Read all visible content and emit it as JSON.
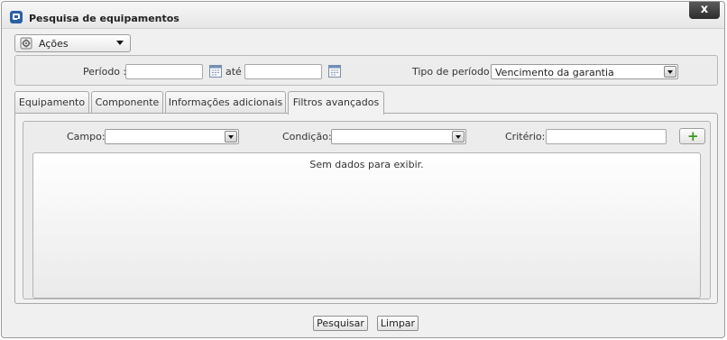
{
  "window": {
    "title": "Pesquisa de equipamentos",
    "close_label": "x"
  },
  "actions": {
    "label": "Ações"
  },
  "period": {
    "label": "Período :",
    "start_value": "",
    "until_label": "até",
    "end_value": "",
    "type_label": "Tipo de período :",
    "type_value": "Vencimento da garantia"
  },
  "tabs": [
    {
      "label": "Equipamento"
    },
    {
      "label": "Componente"
    },
    {
      "label": "Informações adicionais"
    },
    {
      "label": "Filtros avançados",
      "active": true
    }
  ],
  "filters": {
    "field_label": "Campo:",
    "field_value": "",
    "condition_label": "Condição:",
    "condition_value": "",
    "criteria_label": "Critério:",
    "criteria_value": "",
    "add_icon": "plus-icon"
  },
  "grid": {
    "empty_text": "Sem dados para exibir."
  },
  "buttons": {
    "search": "Pesquisar",
    "clear": "Limpar"
  },
  "colors": {
    "add_icon": "#3a9a1a",
    "close_button": "#2c2c2c"
  }
}
